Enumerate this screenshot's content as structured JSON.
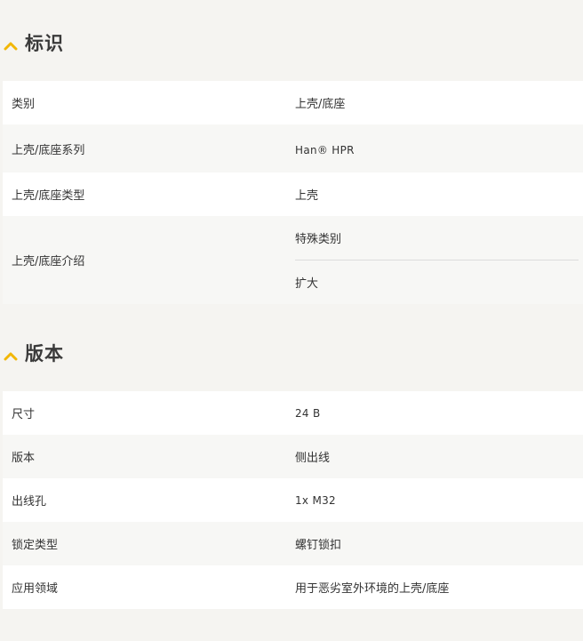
{
  "sections": [
    {
      "title": "标识",
      "rows": [
        {
          "label": "类别",
          "values": [
            "上壳/底座"
          ]
        },
        {
          "label": "上壳/底座系列",
          "values": [
            "Han® HPR"
          ]
        },
        {
          "label": "上壳/底座类型",
          "values": [
            "上壳"
          ]
        },
        {
          "label": "上壳/底座介绍",
          "values": [
            "特殊类别",
            "扩大"
          ]
        }
      ]
    },
    {
      "title": "版本",
      "rows": [
        {
          "label": "尺寸",
          "values": [
            "24 B"
          ]
        },
        {
          "label": "版本",
          "values": [
            "侧出线"
          ]
        },
        {
          "label": "出线孔",
          "values": [
            "1x M32"
          ]
        },
        {
          "label": "锁定类型",
          "values": [
            "螺钉锁扣"
          ]
        },
        {
          "label": "应用领域",
          "values": [
            "用于恶劣室外环境的上壳/底座"
          ]
        }
      ]
    }
  ],
  "colors": {
    "accent": "#f2b705",
    "background": "#f5f4f1",
    "row_white": "#ffffff",
    "row_grey": "#f7f7f5"
  },
  "icons": {
    "section_toggle": "chevron-up-icon"
  }
}
